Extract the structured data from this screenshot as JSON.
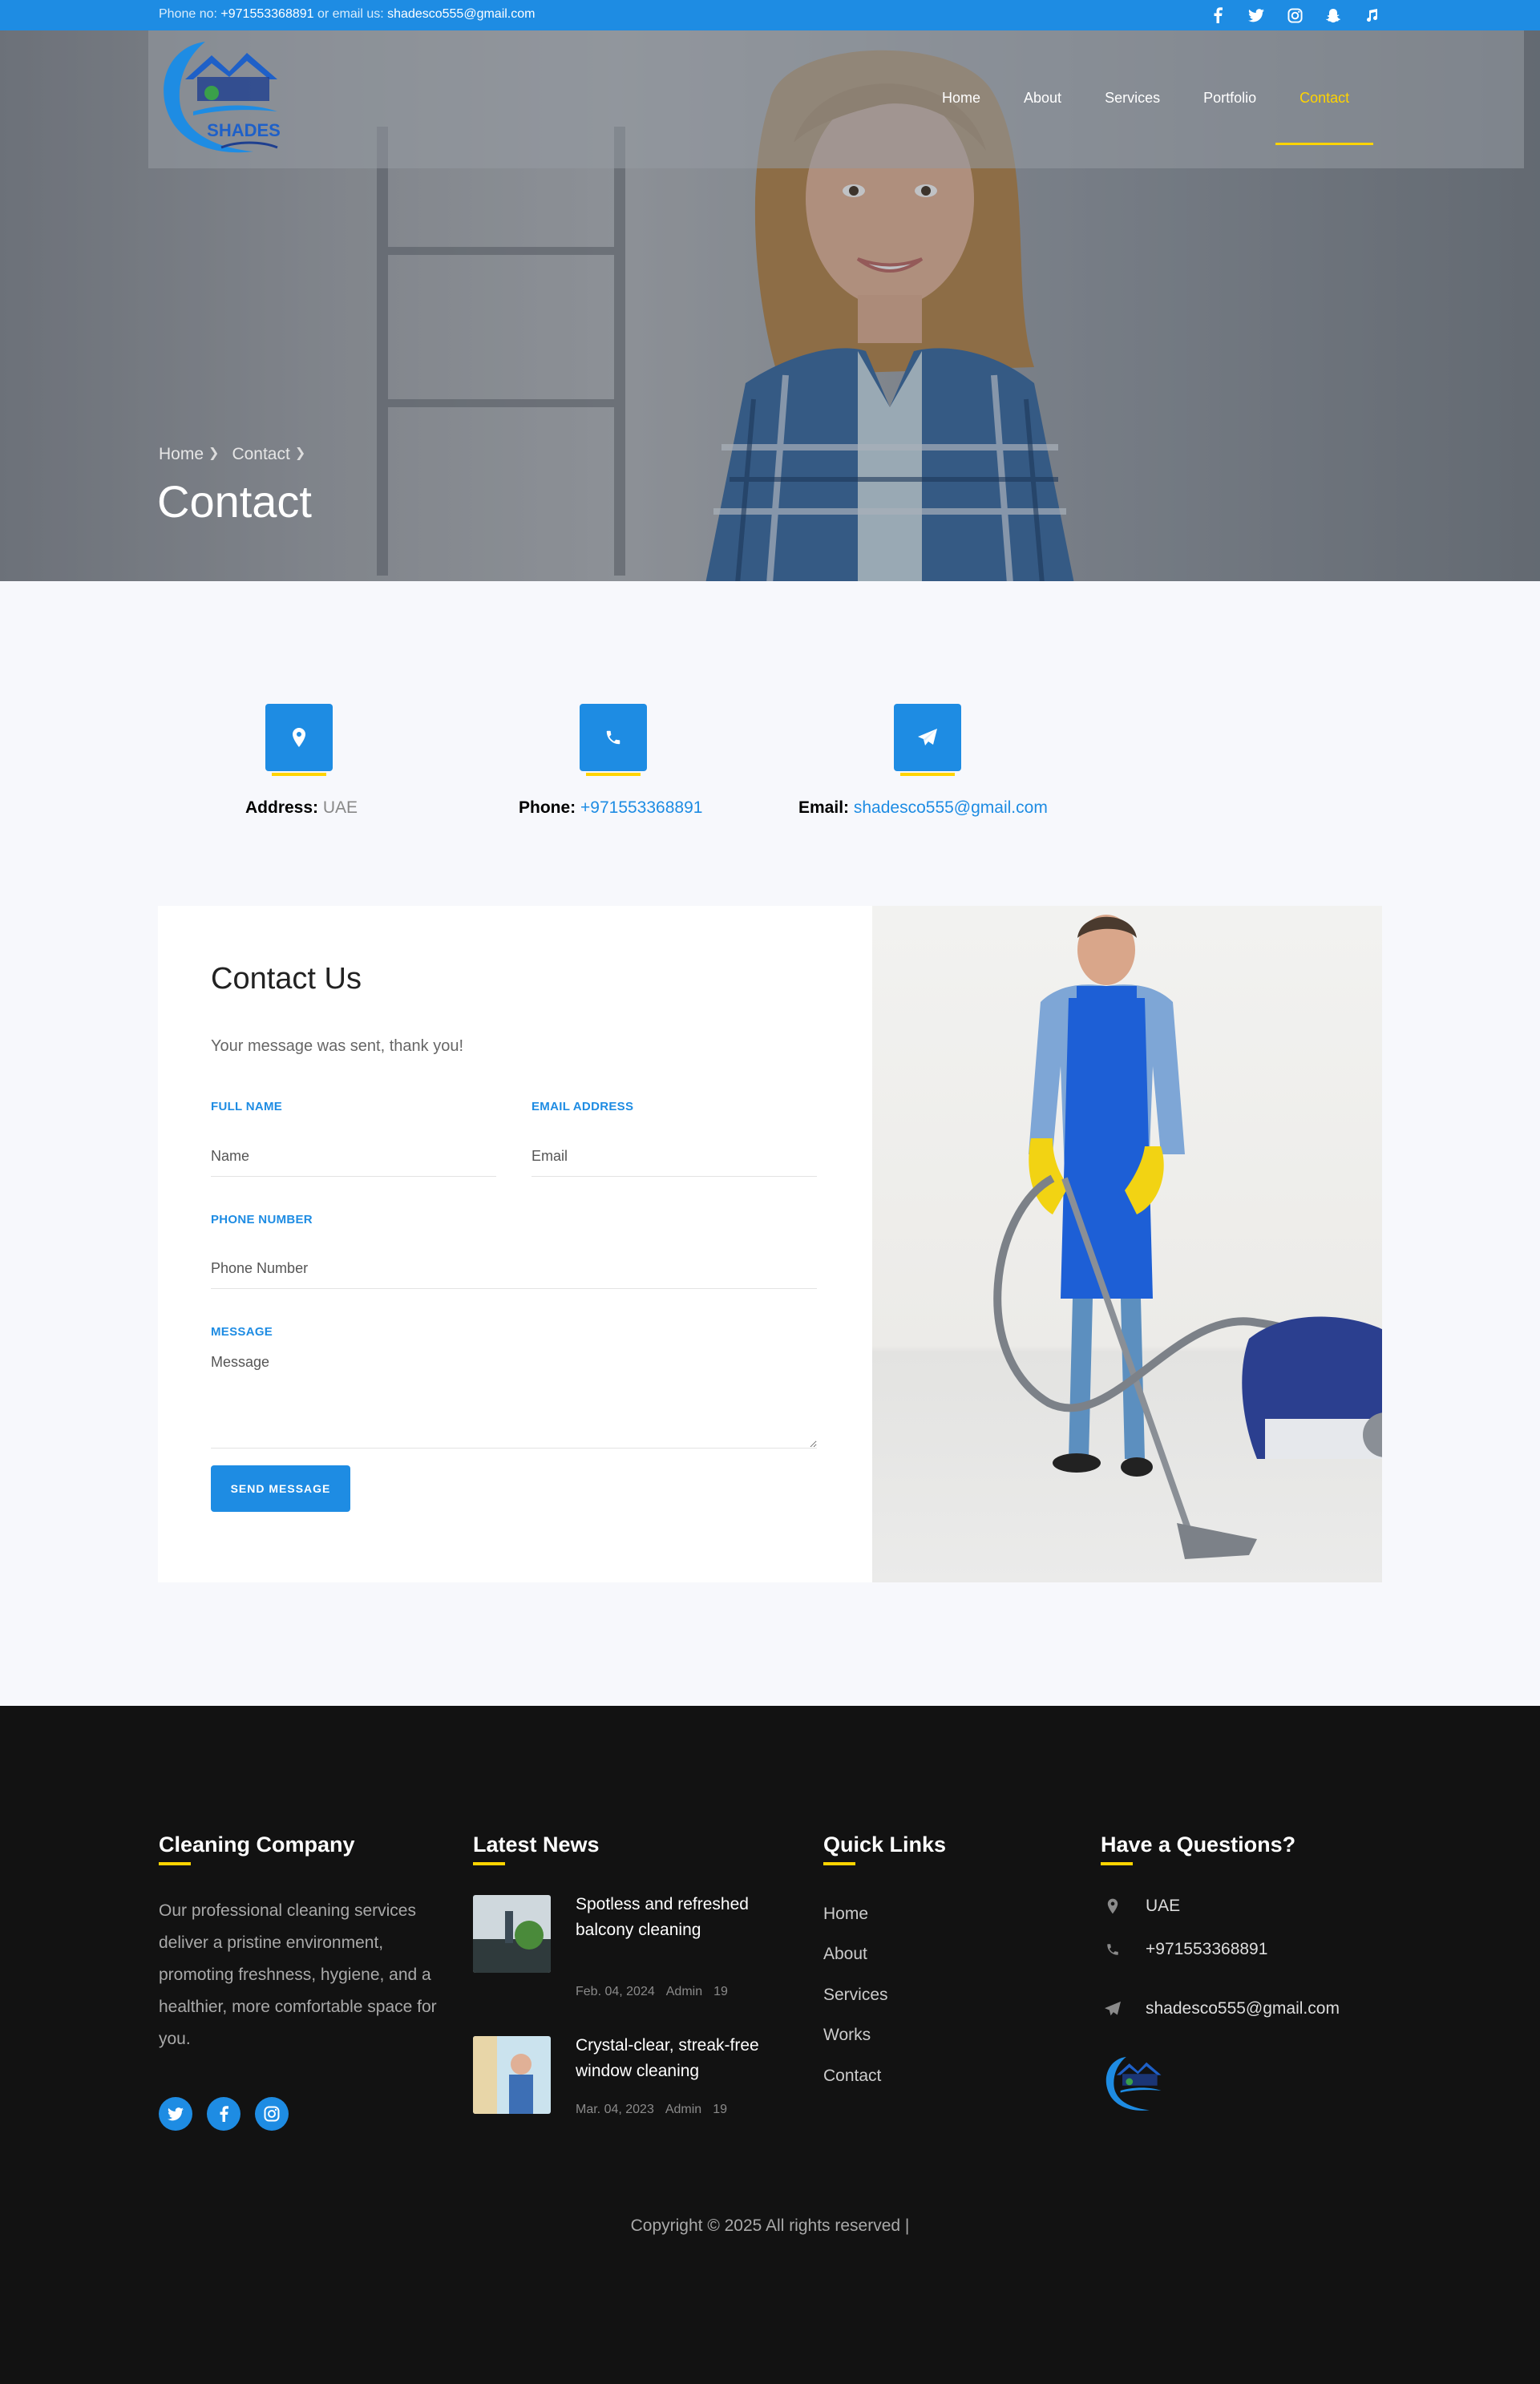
{
  "topbar": {
    "phone_label": "Phone no:",
    "phone": "+971553368891",
    "email_label": "or email us:",
    "email": "shadesco555@gmail.com",
    "social_icons": [
      "facebook-icon",
      "twitter-icon",
      "instagram-icon",
      "snapchat-icon",
      "music-icon"
    ]
  },
  "brand": {
    "logo_text": "SHADES"
  },
  "nav": {
    "items": [
      {
        "label": "Home"
      },
      {
        "label": "About"
      },
      {
        "label": "Services"
      },
      {
        "label": "Portfolio"
      },
      {
        "label": "Contact"
      }
    ],
    "active": "Contact"
  },
  "hero": {
    "breadcrumb": [
      "Home",
      "Contact"
    ],
    "title": "Contact"
  },
  "contact_info": [
    {
      "icon": "map-marker-icon",
      "label": "Address:",
      "value": "UAE"
    },
    {
      "icon": "phone-icon",
      "label": "Phone:",
      "value": "+971553368891"
    },
    {
      "icon": "paper-plane-icon",
      "label": "Email:",
      "value": "shadesco555@gmail.com"
    }
  ],
  "form": {
    "title": "Contact Us",
    "status": "Your message was sent, thank you!",
    "full_name_label": "FULL NAME",
    "full_name_placeholder": "Name",
    "email_label": "EMAIL ADDRESS",
    "email_placeholder": "Email",
    "phone_label": "PHONE NUMBER",
    "phone_placeholder": "Phone Number",
    "message_label": "MESSAGE",
    "message_placeholder": "Message",
    "submit": "SEND MESSAGE"
  },
  "footer": {
    "about_title": "Cleaning Company",
    "about_text": "Our professional cleaning services deliver a pristine environment, promoting freshness, hygiene, and a healthier, more comfortable space for you.",
    "social_icons": [
      "twitter-icon",
      "facebook-icon",
      "instagram-icon"
    ],
    "news_title": "Latest News",
    "news": [
      {
        "title": "Spotless and refreshed balcony cleaning",
        "date": "Feb. 04, 2024",
        "author": "Admin",
        "comments": "19"
      },
      {
        "title": "Crystal-clear, streak-free window cleaning",
        "date": "Mar. 04, 2023",
        "author": "Admin",
        "comments": "19"
      }
    ],
    "links_title": "Quick Links",
    "links": [
      "Home",
      "About",
      "Services",
      "Works",
      "Contact"
    ],
    "questions_title": "Have a Questions?",
    "address": "UAE",
    "phone": "+971553368891",
    "email": "shadesco555@gmail.com",
    "copyright": "Copyright © 2025 All rights reserved |"
  },
  "colors": {
    "primary": "#1e8ce3",
    "accent": "#ffd400",
    "footer_bg": "#121212"
  }
}
